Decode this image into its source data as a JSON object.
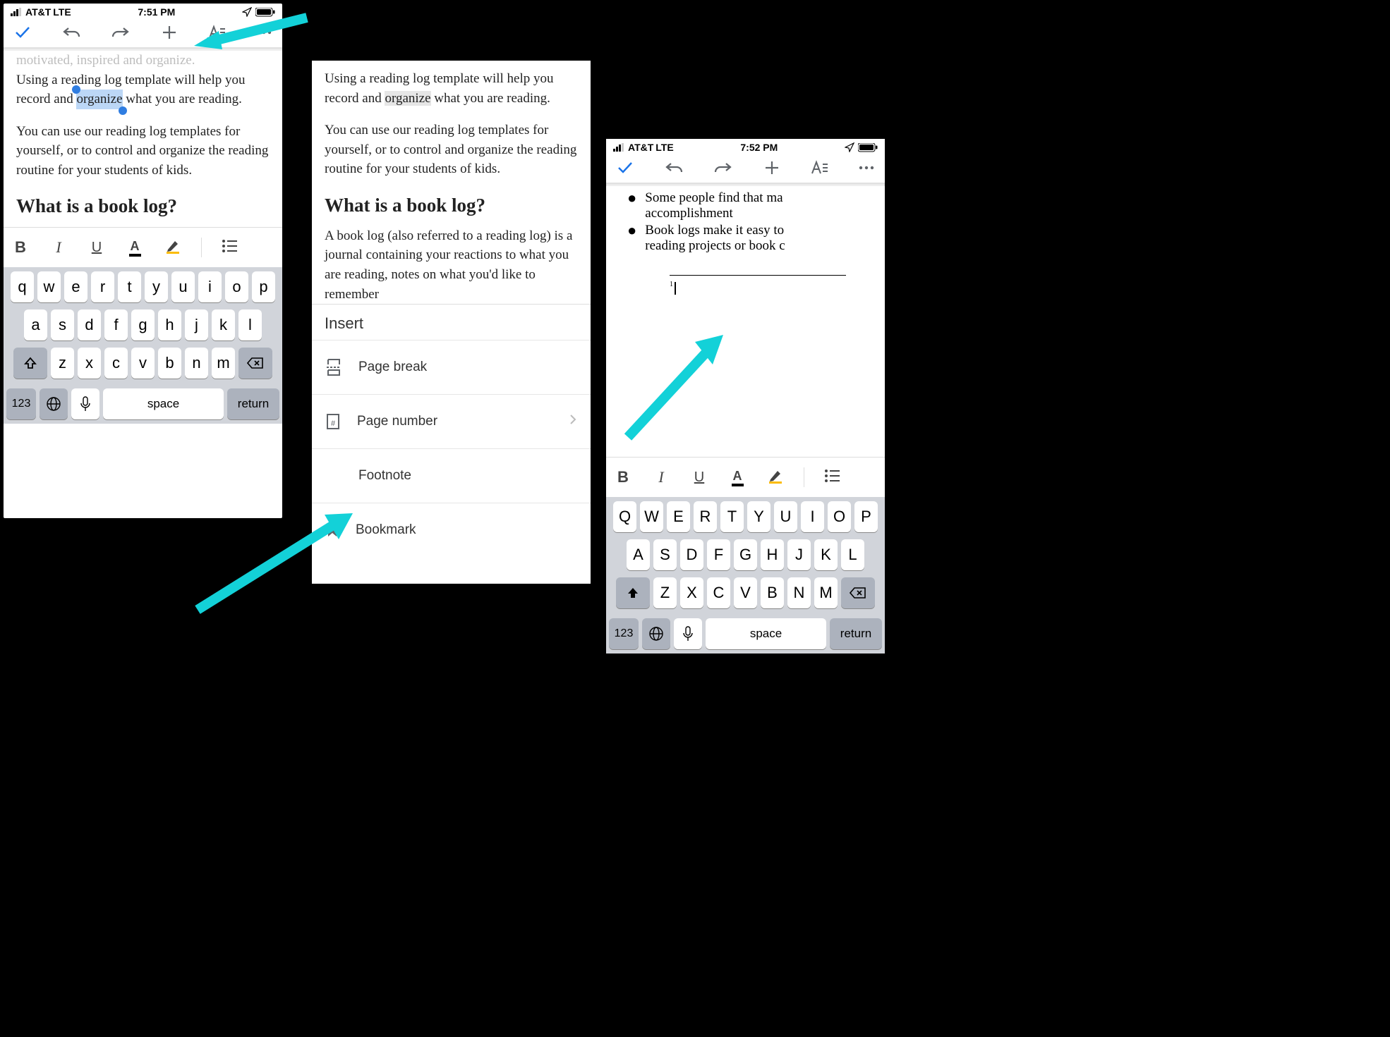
{
  "s1": {
    "status": {
      "carrier": "AT&T",
      "net": "LTE",
      "time": "7:51 PM"
    },
    "doc": {
      "fadedLine": "motivated, inspired and organize.",
      "p1a": "Using a reading log template will help you record and ",
      "selected": "organize",
      "p1b": " what you are reading.",
      "p2": "You can use our reading log templates for yourself, or to control and organize the reading routine for your students of kids.",
      "h": "What is a book log?"
    },
    "kb": {
      "r1": [
        "q",
        "w",
        "e",
        "r",
        "t",
        "y",
        "u",
        "i",
        "o",
        "p"
      ],
      "r2": [
        "a",
        "s",
        "d",
        "f",
        "g",
        "h",
        "j",
        "k",
        "l"
      ],
      "r3": [
        "z",
        "x",
        "c",
        "v",
        "b",
        "n",
        "m"
      ],
      "numKey": "123",
      "space": "space",
      "ret": "return"
    }
  },
  "s2": {
    "p1": "Using a reading log template will help you record and organize what you are reading.",
    "p2": "You can use our reading log templates for yourself, or to control and organize the reading routine for your students of kids.",
    "h": "What is a book log?",
    "p3": "A book log (also referred to a reading log) is a journal containing your reactions to what you are reading, notes on what you'd like to remember",
    "insertTitle": "Insert",
    "items": {
      "pb": "Page break",
      "pn": "Page number",
      "fn": "Footnote",
      "bm": "Bookmark"
    }
  },
  "s3": {
    "status": {
      "carrier": "AT&T",
      "net": "LTE",
      "time": "7:52 PM"
    },
    "b1": "Some people find that ma",
    "b1b": "accomplishment",
    "b2": "Book logs make it easy to",
    "b2b": "reading projects or book c",
    "fnNum": "1",
    "kb": {
      "r1": [
        "Q",
        "W",
        "E",
        "R",
        "T",
        "Y",
        "U",
        "I",
        "O",
        "P"
      ],
      "r2": [
        "A",
        "S",
        "D",
        "F",
        "G",
        "H",
        "J",
        "K",
        "L"
      ],
      "r3": [
        "Z",
        "X",
        "C",
        "V",
        "B",
        "N",
        "M"
      ],
      "numKey": "123",
      "space": "space",
      "ret": "return"
    }
  }
}
